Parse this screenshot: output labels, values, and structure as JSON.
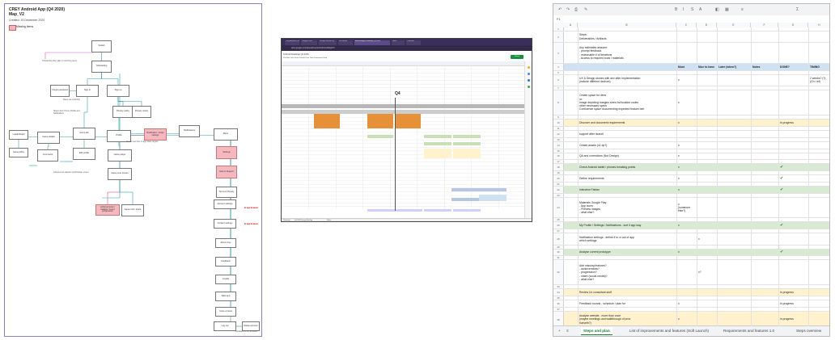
{
  "panel1": {
    "title": "CREY Android App (Q4 2020)",
    "subtitle": "Map_V2",
    "created": "Created: 15 December 2020",
    "legend_label": "Missing items",
    "footer": "Updated on 15.12.2020",
    "nodes": [
      {
        "label": "Splash",
        "pink": false
      },
      {
        "label": "Onboarding",
        "pink": false
      },
      {
        "label": "Sign in",
        "pink": false
      },
      {
        "label": "Sign up",
        "pink": false
      },
      {
        "label": "Forgot password",
        "pink": false
      },
      {
        "label": "Privacy policy",
        "pink": false
      },
      {
        "label": "Privacy notice",
        "pink": false
      },
      {
        "label": "Game details",
        "pink": false
      },
      {
        "label": "Home tab",
        "pink": false
      },
      {
        "label": "Profile",
        "pink": false
      },
      {
        "label": "Notification / share settings",
        "pink": true
      },
      {
        "label": "Notifications",
        "pink": false
      },
      {
        "label": "Menu",
        "pink": false
      },
      {
        "label": "Leaderboard",
        "pink": false
      },
      {
        "label": "Game lobby",
        "pink": false
      },
      {
        "label": "Comments",
        "pink": false
      },
      {
        "label": "Edit profile",
        "pink": false
      },
      {
        "label": "Game player",
        "pink": false
      },
      {
        "label": "Game over screen",
        "pink": false
      },
      {
        "label": "Achievements / badges / Level progression",
        "pink": true
      },
      {
        "label": "Game end / share",
        "pink": false
      },
      {
        "label": "Settings",
        "pink": true
      },
      {
        "label": "Help & Support",
        "pink": true
      },
      {
        "label": "Terms & Privacy",
        "pink": false
      },
      {
        "label": "Account settings",
        "pink": false
      },
      {
        "label": "Content settings",
        "pink": false
      },
      {
        "label": "About Crey",
        "pink": false
      },
      {
        "label": "Feedback",
        "pink": false
      },
      {
        "label": "Credits",
        "pink": false
      },
      {
        "label": "Rate app",
        "pink": false
      },
      {
        "label": "Invite a friend",
        "pink": false
      },
      {
        "label": "Log out",
        "pink": false
      },
      {
        "label": "Delete account",
        "pink": false
      }
    ],
    "notes": [
      {
        "text": "Onboarding flow: skip on returning users",
        "red": false
      },
      {
        "text": "Reset via email link",
        "red": false
      },
      {
        "text": "Shown from Home, Profile and Notifications",
        "red": false
      },
      {
        "text": "Needs new flow: in-app share targets",
        "red": false
      },
      {
        "text": "Add account deletion confirmation screen",
        "red": false
      },
      {
        "text": "In app browser",
        "red": true
      },
      {
        "text": "In app browser",
        "red": true
      }
    ]
  },
  "panel2": {
    "tabs": [
      "Crey Android | Roadmap",
      "Google Drive",
      "Design Review Q4",
      "Jira Board",
      "Android App Roadmap Q4 2020",
      "Slack",
      "Calendar"
    ],
    "url": "docs.google.com/spreadsheets/d/1AbC/edit#gid=0",
    "doc_title": "Android Roadmap Q4 2020",
    "menu": "File  Edit  View  Insert  Format  Data  Tools  Extensions  Help",
    "share_label": "Share",
    "q4_label": "Q4",
    "sheet_tabs": [
      "Roadmap",
      "Q4 2020 Design Backlog",
      "Notes"
    ]
  },
  "panel3": {
    "cell_ref": "F1",
    "columns": [
      "A",
      "B",
      "C",
      "D",
      "E",
      "F",
      "G",
      "H"
    ],
    "rows": [
      {
        "n": "1",
        "b": "",
        "c": "",
        "d": "",
        "e": "",
        "f": "",
        "g": "",
        "h": "",
        "bg": "#ffffff",
        "bold": false
      },
      {
        "n": "2",
        "b": "Steps:\nDeliverables / Artifacts",
        "c": "",
        "d": "",
        "e": "",
        "f": "",
        "g": "",
        "h": "",
        "bg": "#ffffff",
        "bold": false
      },
      {
        "n": "3",
        "b": "Any estimates assume:\n- prompt feedback\n- reasonable # of iterations\n- Access to required tools / materials",
        "c": "",
        "d": "",
        "e": "",
        "f": "",
        "g": "",
        "h": "",
        "bg": "#ffffff",
        "bold": false
      },
      {
        "n": "4",
        "b": "",
        "c": "Must",
        "d": "Nice to have",
        "e": "Later (when?)",
        "f": "Notes",
        "g": "DONE?",
        "h": "TIMING",
        "bg": "#cfe2f3",
        "bold": true
      },
      {
        "n": "5",
        "b": "",
        "c": "",
        "d": "",
        "e": "",
        "f": "",
        "g": "",
        "h": "",
        "bg": "#ffffff",
        "bold": false
      },
      {
        "n": "6",
        "b": "UX & Design stories with dev after implementation\n(include different devices)",
        "c": "x",
        "d": "",
        "e": "",
        "f": "",
        "g": "",
        "h": "2 weeks? (?)\n(Ch / wf)",
        "bg": "#ffffff",
        "bold": false
      },
      {
        "n": "7",
        "b": "",
        "c": "",
        "d": "",
        "e": "",
        "f": "",
        "g": "",
        "h": "",
        "bg": "#ffffff",
        "bold": false
      },
      {
        "n": "8",
        "b": "Create space for devs\nor:\nImage depicting margins sizes for/location codes\nother necessary specs\nConfluence space documenting expected feature beh",
        "c": "x",
        "d": "",
        "e": "",
        "f": "",
        "g": "",
        "h": "",
        "bg": "#ffffff",
        "bold": false
      },
      {
        "n": "9",
        "b": "",
        "c": "",
        "d": "",
        "e": "",
        "f": "",
        "g": "",
        "h": "",
        "bg": "#ffffff",
        "bold": false
      },
      {
        "n": "10",
        "b": "Discover and document requirements",
        "c": "x",
        "d": "",
        "e": "",
        "f": "",
        "g": "in progress",
        "h": "",
        "bg": "#fff2cc",
        "bold": false
      },
      {
        "n": "11",
        "b": "",
        "c": "",
        "d": "",
        "e": "",
        "f": "",
        "g": "",
        "h": "",
        "bg": "#ffffff",
        "bold": false
      },
      {
        "n": "12",
        "b": "support after launch",
        "c": "",
        "d": "",
        "e": "",
        "f": "",
        "g": "",
        "h": "",
        "bg": "#ffffff",
        "bold": false
      },
      {
        "n": "13",
        "b": "",
        "c": "",
        "d": "",
        "e": "",
        "f": "",
        "g": "",
        "h": "",
        "bg": "#ffffff",
        "bold": false
      },
      {
        "n": "14",
        "b": "Create assets (x1 dp?)",
        "c": "x",
        "d": "",
        "e": "",
        "f": "",
        "g": "",
        "h": "",
        "bg": "#ffffff",
        "bold": false
      },
      {
        "n": "15",
        "b": "",
        "c": "",
        "d": "",
        "e": "",
        "f": "",
        "g": "",
        "h": "",
        "bg": "#ffffff",
        "bold": false
      },
      {
        "n": "16",
        "b": "QA and corrections (Not Design)",
        "c": "x",
        "d": "",
        "e": "",
        "f": "",
        "g": "",
        "h": "",
        "bg": "#ffffff",
        "bold": false
      },
      {
        "n": "17",
        "b": "",
        "c": "",
        "d": "",
        "e": "",
        "f": "",
        "g": "",
        "h": "",
        "bg": "#ffffff",
        "bold": false
      },
      {
        "n": "18",
        "b": "Check Android tablet / phones breaking points",
        "c": "x",
        "d": "",
        "e": "",
        "f": "",
        "g": "✔",
        "h": "",
        "bg": "#d9ead3",
        "bold": false
      },
      {
        "n": "19",
        "b": "",
        "c": "",
        "d": "",
        "e": "",
        "f": "",
        "g": "",
        "h": "",
        "bg": "#ffffff",
        "bold": false
      },
      {
        "n": "20",
        "b": "Define requirements",
        "c": "x",
        "d": "",
        "e": "",
        "f": "",
        "g": "✔",
        "h": "",
        "bg": "#ffffff",
        "bold": false
      },
      {
        "n": "21",
        "b": "",
        "c": "",
        "d": "",
        "e": "",
        "f": "",
        "g": "",
        "h": "",
        "bg": "#ffffff",
        "bold": false
      },
      {
        "n": "22",
        "b": "Interview Fabian",
        "c": "x",
        "d": "",
        "e": "",
        "f": "",
        "g": "✔",
        "h": "",
        "bg": "#d9ead3",
        "bold": false
      },
      {
        "n": "23",
        "b": "",
        "c": "",
        "d": "",
        "e": "",
        "f": "",
        "g": "",
        "h": "",
        "bg": "#ffffff",
        "bold": false
      },
      {
        "n": "24",
        "b": "Materials Google Play:\n- App icons\n- Preview images\n- what else?",
        "c": "x\n(someone else?)",
        "d": "",
        "e": "",
        "f": "",
        "g": "",
        "h": "",
        "bg": "#ffffff",
        "bold": false
      },
      {
        "n": "25",
        "b": "",
        "c": "",
        "d": "",
        "e": "",
        "f": "",
        "g": "",
        "h": "",
        "bg": "#ffffff",
        "bold": false
      },
      {
        "n": "26",
        "b": "My Profile / Settings / Notifications - sort it app way",
        "c": "x",
        "d": "",
        "e": "",
        "f": "",
        "g": "✔",
        "h": "",
        "bg": "#d9ead3",
        "bold": false
      },
      {
        "n": "27",
        "b": "",
        "c": "",
        "d": "",
        "e": "",
        "f": "",
        "g": "",
        "h": "",
        "bg": "#ffffff",
        "bold": false
      },
      {
        "n": "28",
        "b": "Notification settings - define if in or out of app\nwhich settings",
        "c": "",
        "d": "x",
        "e": "",
        "f": "",
        "g": "",
        "h": "",
        "bg": "#ffffff",
        "bold": false
      },
      {
        "n": "29",
        "b": "",
        "c": "",
        "d": "",
        "e": "",
        "f": "",
        "g": "",
        "h": "",
        "bg": "#ffffff",
        "bold": false
      },
      {
        "n": "30",
        "b": "Analyse current prototype",
        "c": "x",
        "d": "",
        "e": "",
        "f": "",
        "g": "✔",
        "h": "",
        "bg": "#d9ead3",
        "bold": false
      },
      {
        "n": "31",
        "b": "",
        "c": "",
        "d": "",
        "e": "",
        "f": "",
        "g": "",
        "h": "",
        "bg": "#ffffff",
        "bold": false
      },
      {
        "n": "32",
        "b": "Add missing features?\n- achievements?\n- progression?\n- share (social media)?\n- what else?",
        "c": "",
        "d": "x?",
        "e": "",
        "f": "",
        "g": "",
        "h": "",
        "bg": "#ffffff",
        "bold": false
      },
      {
        "n": "33",
        "b": "",
        "c": "",
        "d": "",
        "e": "",
        "f": "",
        "g": "",
        "h": "",
        "bg": "#ffffff",
        "bold": false
      },
      {
        "n": "34",
        "b": "Review Ux consultant stuff",
        "c": "",
        "d": "",
        "e": "",
        "f": "",
        "g": "in progress",
        "h": "",
        "bg": "#fff2cc",
        "bold": false
      },
      {
        "n": "35",
        "b": "",
        "c": "",
        "d": "",
        "e": "",
        "f": "",
        "g": "",
        "h": "",
        "bg": "#ffffff",
        "bold": false
      },
      {
        "n": "36",
        "b": "Feedback rounds - schedule / plan for",
        "c": "x",
        "d": "",
        "e": "",
        "f": "",
        "g": "in progress",
        "h": "",
        "bg": "#ffffff",
        "bold": false
      },
      {
        "n": "37",
        "b": "",
        "c": "",
        "d": "",
        "e": "",
        "f": "",
        "g": "",
        "h": "",
        "bg": "#ffffff",
        "bold": false
      },
      {
        "n": "38",
        "b": "Analyse website - more than once\n(maybe meetings and walkthrough of pros\nKarseth?)",
        "c": "x",
        "d": "",
        "e": "",
        "f": "",
        "g": "in progress",
        "h": "",
        "bg": "#fff2cc",
        "bold": false
      }
    ],
    "sheet_tabs": [
      {
        "label": "Steps and plan",
        "active": true
      },
      {
        "label": "List of improvements and features (Soft Launch)",
        "active": false
      },
      {
        "label": "Requirements and features 1.0",
        "active": false
      },
      {
        "label": "Steps overview",
        "active": false
      }
    ]
  }
}
